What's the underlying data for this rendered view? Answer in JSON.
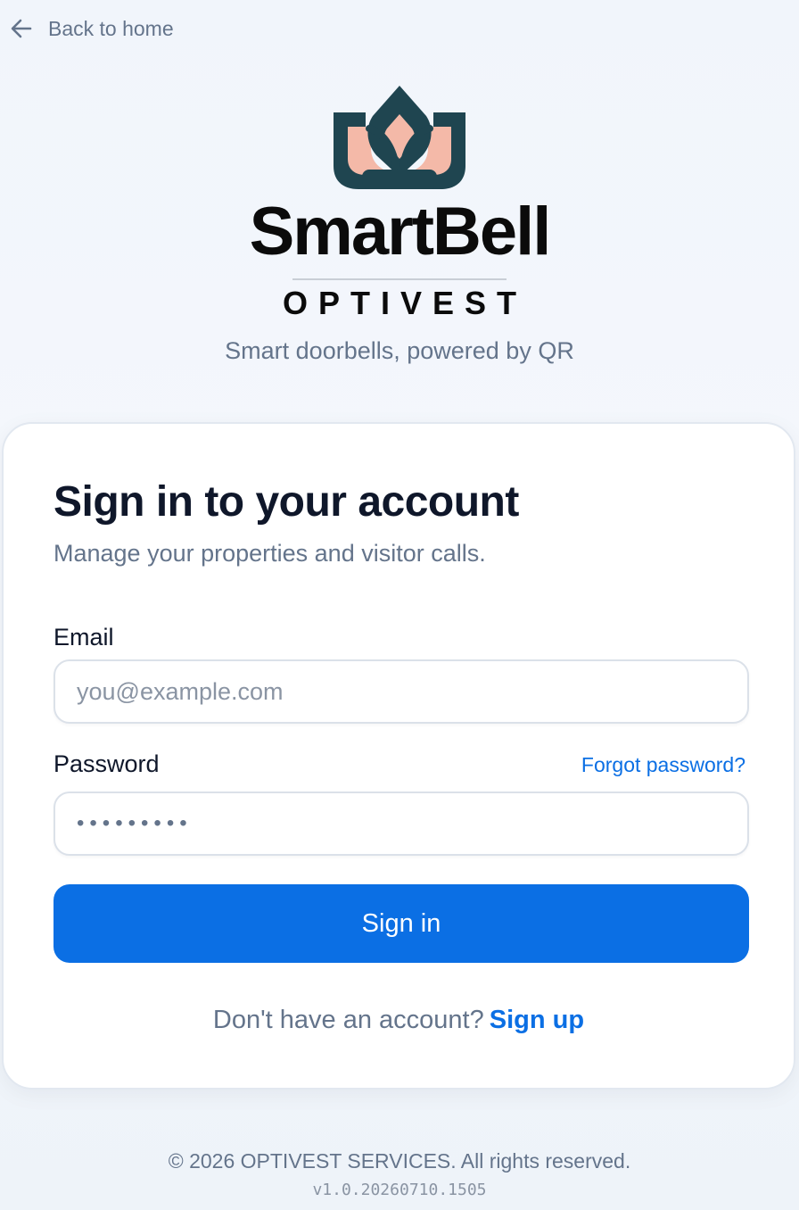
{
  "nav": {
    "back_label": "Back to home",
    "back_icon": "arrow-left-icon"
  },
  "brand": {
    "logo_icon": "lotus-bell-logo-icon",
    "name": "SmartBell",
    "subname": "OPTIVEST",
    "tagline": "Smart doorbells, powered by QR"
  },
  "signin": {
    "title": "Sign in to your account",
    "subtitle": "Manage your properties and visitor calls.",
    "email_label": "Email",
    "email_placeholder": "you@example.com",
    "email_value": "",
    "password_label": "Password",
    "password_value": "•••••••••",
    "forgot_label": "Forgot password?",
    "submit_label": "Sign in",
    "signup_prompt": "Don't have an account?",
    "signup_label": "Sign up"
  },
  "footer": {
    "copyright": "© 2026 OPTIVEST SERVICES. All rights reserved.",
    "version": "v1.0.20260710.1505"
  },
  "colors": {
    "primary": "#0b6fe4",
    "logo_teal": "#1f4550",
    "logo_peach": "#f4b9a8",
    "text_dark": "#0f172a",
    "text_muted": "#64748b"
  }
}
